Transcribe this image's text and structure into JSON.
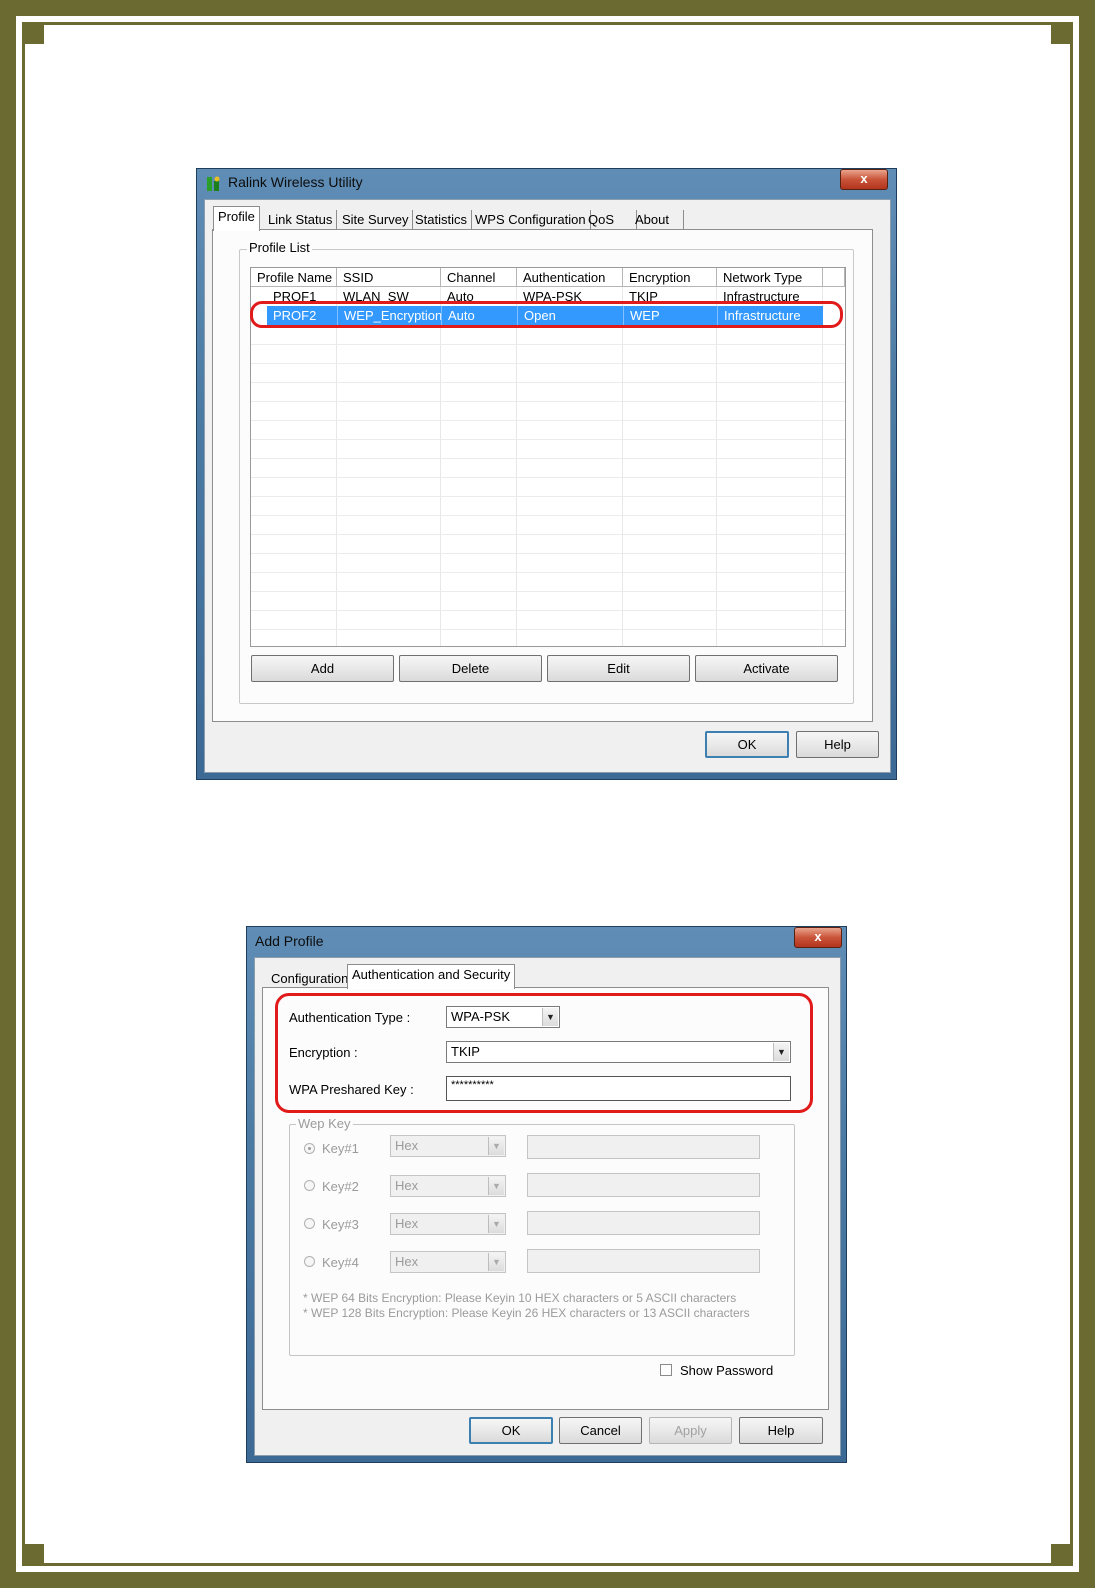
{
  "colors": {
    "page_border": "#6b6a30",
    "selection": "#3399ff",
    "highlight_oval": "#e11a1a"
  },
  "window1": {
    "title": "Ralink Wireless Utility",
    "close_glyph": "x",
    "tabs": [
      "Profile",
      "Link Status",
      "Site Survey",
      "Statistics",
      "WPS Configuration",
      "QoS",
      "About"
    ],
    "active_tab": "Profile",
    "group_title": "Profile List",
    "columns": [
      "Profile Name",
      "SSID",
      "Channel",
      "Authentication",
      "Encryption",
      "Network Type"
    ],
    "rows": [
      [
        "PROF1",
        "WLAN_SW",
        "Auto",
        "WPA-PSK",
        "TKIP",
        "Infrastructure"
      ],
      [
        "PROF2",
        "WEP_Encryption",
        "Auto",
        "Open",
        "WEP",
        "Infrastructure"
      ]
    ],
    "selected_row": 1,
    "buttons": {
      "add": "Add",
      "delete": "Delete",
      "edit": "Edit",
      "activate": "Activate"
    },
    "footer": {
      "ok": "OK",
      "help": "Help"
    }
  },
  "window2": {
    "title": "Add Profile",
    "close_glyph": "x",
    "tabs": [
      "Configuration",
      "Authentication and Security"
    ],
    "active_tab": "Authentication and Security",
    "auth_type": {
      "label": "Authentication Type :",
      "value": "WPA-PSK"
    },
    "encryption": {
      "label": "Encryption :",
      "value": "TKIP"
    },
    "wpa_key": {
      "label": "WPA Preshared Key :",
      "value": "**********"
    },
    "wep_group_title": "Wep Key",
    "wep_keys": [
      {
        "label": "Key#1",
        "format": "Hex",
        "selected": true
      },
      {
        "label": "Key#2",
        "format": "Hex",
        "selected": false
      },
      {
        "label": "Key#3",
        "format": "Hex",
        "selected": false
      },
      {
        "label": "Key#4",
        "format": "Hex",
        "selected": false
      }
    ],
    "notes": [
      "* WEP 64 Bits Encryption:  Please Keyin 10 HEX characters or 5 ASCII characters",
      "* WEP 128 Bits Encryption:  Please Keyin 26 HEX characters or 13 ASCII characters"
    ],
    "show_password": {
      "label": "Show Password",
      "checked": false
    },
    "buttons": {
      "ok": "OK",
      "cancel": "Cancel",
      "apply": "Apply",
      "help": "Help"
    }
  }
}
